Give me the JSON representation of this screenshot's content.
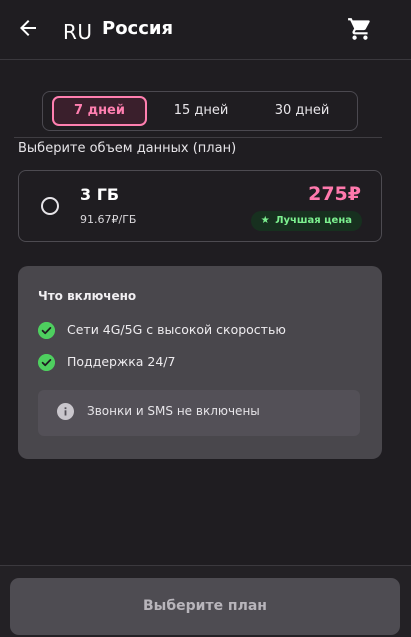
{
  "header": {
    "back_icon": "arrow-left-icon",
    "country_code": "RU",
    "country_name": "Россия",
    "cart_icon": "shopping-cart-icon"
  },
  "tabs": [
    {
      "label": "7 дней",
      "active": true
    },
    {
      "label": "15 дней",
      "active": false
    },
    {
      "label": "30 дней",
      "active": false
    }
  ],
  "section_label": "Выберите объем данных (план)",
  "plan": {
    "name": "3 ГБ",
    "unit_price": "91.67₽/ГБ",
    "price": "275₽",
    "badge": "Лучшая цена",
    "badge_icon": "star-icon",
    "selected": false
  },
  "included": {
    "title": "Что включено",
    "features": [
      {
        "text": "Сети 4G/5G с высокой скоростью",
        "icon": "check-circle-icon"
      },
      {
        "text": "Поддержка 24/7",
        "icon": "check-circle-icon"
      }
    ],
    "notice": {
      "text": "Звонки и SMS не включены",
      "icon": "info-icon"
    }
  },
  "cta": {
    "label": "Выберите план",
    "enabled": false
  },
  "colors": {
    "background": "#1f1d21",
    "accent": "#ff79ad",
    "success": "#4ecf5f",
    "card": "#49474c",
    "button_disabled": "#4e4c52"
  }
}
